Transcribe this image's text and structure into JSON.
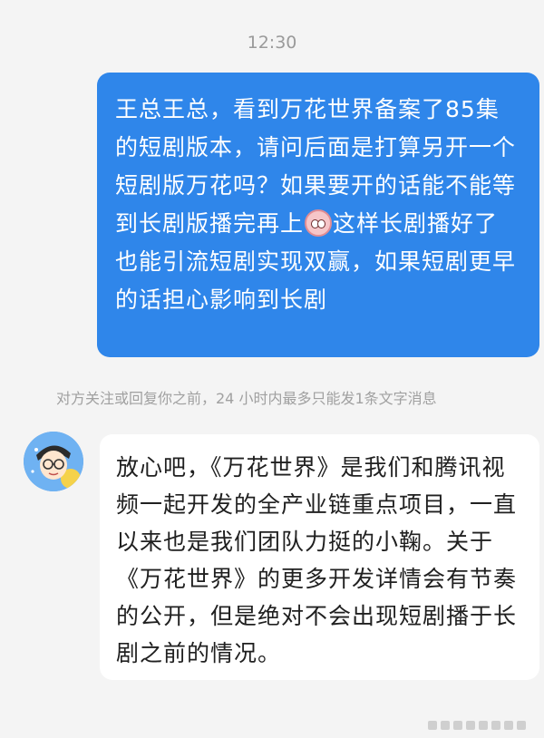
{
  "timestamp": "12:30",
  "outgoing": {
    "text_before_emoji": "王总王总，看到万花世界备案了85集的短剧版本，请问后面是打算另开一个短剧版万花吗？如果要开的话能不能等到长剧版播完再上",
    "emoji_icon": "crying-face-icon",
    "text_after_emoji": "这样长剧播好了也能引流短剧实现双赢，如果短剧更早的话担心影响到长剧"
  },
  "notice": "对方关注或回复你之前，24 小时内最多只能发1条文字消息",
  "incoming": {
    "avatar_icon": "cartoon-avatar-icon",
    "text": "放心吧，《万花世界》是我们和腾讯视频一起开发的全产业链重点项目，一直以来也是我们团队力挺的小鞠。关于《万花世界》的更多开发详情会有节奏的公开，但是绝对不会出现短剧播于长剧之前的情况。"
  },
  "watermark_icon": "watermark-icon"
}
